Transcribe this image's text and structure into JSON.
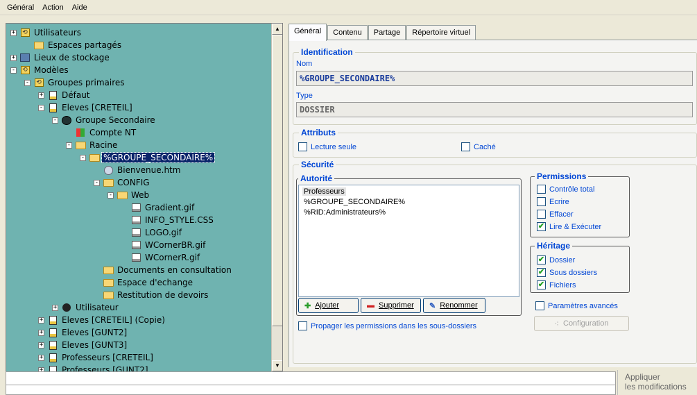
{
  "menu": [
    "Général",
    "Action",
    "Aide"
  ],
  "tree": [
    {
      "label": "Utilisateurs",
      "exp": "+",
      "icon": "group-icon"
    },
    {
      "label": "Espaces partagés",
      "exp": "",
      "icon": "shared-folder-icon"
    },
    {
      "label": "Lieux de stockage",
      "exp": "+",
      "icon": "storage-icon"
    },
    {
      "label": "Modèles",
      "exp": "-",
      "icon": "group-icon"
    },
    {
      "label": "Groupes primaires",
      "exp": "-",
      "icon": "group-icon"
    },
    {
      "label": "Défaut",
      "exp": "+",
      "icon": "document-icon"
    },
    {
      "label": "Eleves [CRETEIL]",
      "exp": "-",
      "icon": "document-icon"
    },
    {
      "label": "Groupe Secondaire",
      "exp": "-",
      "icon": "users-icon"
    },
    {
      "label": "Compte NT",
      "exp": "",
      "icon": "windows-icon"
    },
    {
      "label": "Racine",
      "exp": "-",
      "icon": "folder-icon"
    },
    {
      "label": "%GROUPE_SECONDAIRE%",
      "exp": "-",
      "icon": "folder-icon",
      "selected": true
    },
    {
      "label": "Bienvenue.htm",
      "exp": "",
      "icon": "web-file-icon"
    },
    {
      "label": "CONFIG",
      "exp": "-",
      "icon": "folder-icon"
    },
    {
      "label": "Web",
      "exp": "-",
      "icon": "folder-icon"
    },
    {
      "label": "Gradient.gif",
      "exp": "",
      "icon": "image-file-icon"
    },
    {
      "label": "INFO_STYLE.CSS",
      "exp": "",
      "icon": "image-file-icon"
    },
    {
      "label": "LOGO.gif",
      "exp": "",
      "icon": "image-file-icon"
    },
    {
      "label": "WCornerBR.gif",
      "exp": "",
      "icon": "image-file-icon"
    },
    {
      "label": "WCornerR.gif",
      "exp": "",
      "icon": "image-file-icon"
    },
    {
      "label": "Documents en consultation",
      "exp": "",
      "icon": "folder-icon"
    },
    {
      "label": "Espace d'echange",
      "exp": "",
      "icon": "folder-icon"
    },
    {
      "label": "Restitution de devoirs",
      "exp": "",
      "icon": "folder-icon"
    },
    {
      "label": "Utilisateur",
      "exp": "+",
      "icon": "user-icon"
    },
    {
      "label": "Eleves [CRETEIL] (Copie)",
      "exp": "+",
      "icon": "document-icon"
    },
    {
      "label": "Eleves [GUNT2]",
      "exp": "+",
      "icon": "document-icon"
    },
    {
      "label": "Eleves [GUNT3]",
      "exp": "+",
      "icon": "document-icon"
    },
    {
      "label": "Professeurs [CRETEIL]",
      "exp": "+",
      "icon": "document-icon"
    },
    {
      "label": "Professeurs [GUNT2]",
      "exp": "+",
      "icon": "document-icon"
    }
  ],
  "tabs": [
    "Général",
    "Contenu",
    "Partage",
    "Répertoire virtuel"
  ],
  "identification": {
    "title": "Identification",
    "nom_label": "Nom",
    "nom_value": "%GROUPE_SECONDAIRE%",
    "type_label": "Type",
    "type_value": "DOSSIER"
  },
  "attributs": {
    "title": "Attributs",
    "lecture_seule": "Lecture seule",
    "cache": "Caché"
  },
  "securite": {
    "title": "Sécurité",
    "autorite_title": "Autorité",
    "autorites": [
      "Professeurs",
      "%GROUPE_SECONDAIRE%",
      "%RID:Administrateurs%"
    ],
    "ajouter": "Ajouter",
    "supprimer": "Supprimer",
    "renommer": "Renommer",
    "propager": "Propager les permissions dans les sous-dossiers"
  },
  "permissions": {
    "title": "Permissions",
    "items": [
      {
        "label": "Contrôle total",
        "checked": false
      },
      {
        "label": "Ecrire",
        "checked": false
      },
      {
        "label": "Effacer",
        "checked": false
      },
      {
        "label": "Lire & Exécuter",
        "checked": true
      }
    ]
  },
  "heritage": {
    "title": "Héritage",
    "items": [
      {
        "label": "Dossier",
        "checked": true
      },
      {
        "label": "Sous dossiers",
        "checked": true
      },
      {
        "label": "Fichiers",
        "checked": true
      }
    ]
  },
  "parametres_avances": "Paramètres avancés",
  "configuration": "Configuration",
  "apply": {
    "line1": "Appliquer",
    "line2": "les modifications"
  }
}
